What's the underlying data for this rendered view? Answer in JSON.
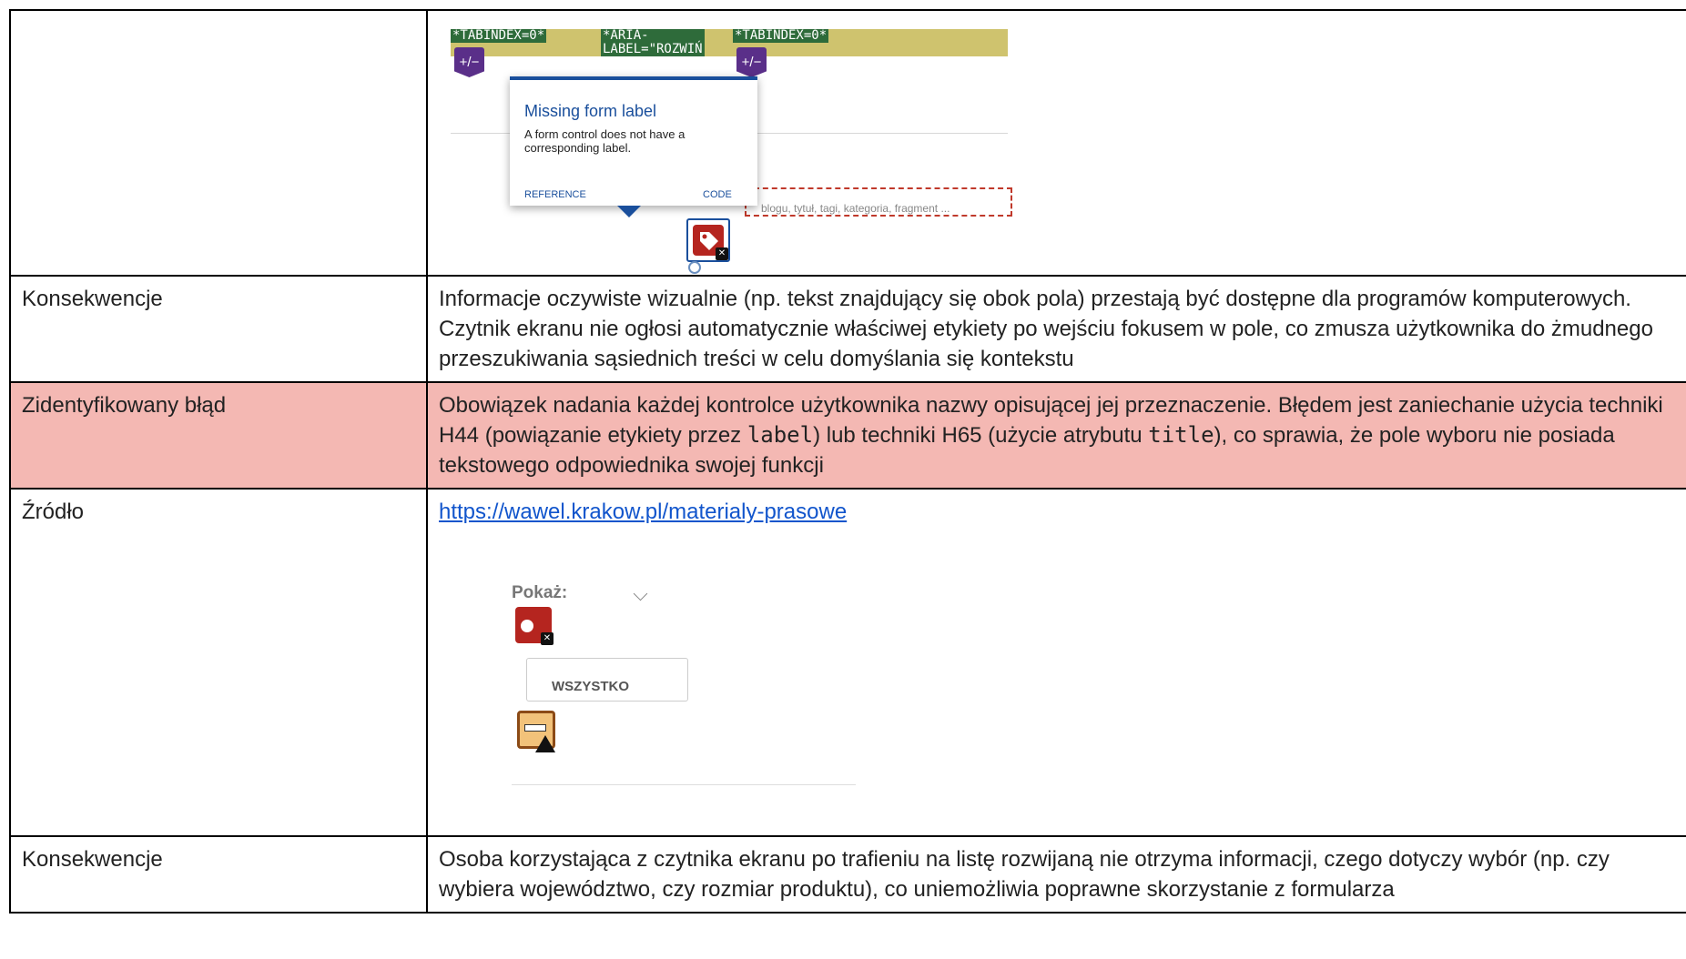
{
  "rows": [
    {
      "label": "",
      "screenshot": {
        "tab_tags": [
          "*TABINDEX=0*",
          "*ARIA-LABEL=\"ROZWIŃ MENU SKLEP\"*",
          "*TABINDEX=0*"
        ],
        "expand_badge": "+/−",
        "popup": {
          "title": "Missing form label",
          "body": "A form control does not have a corresponding label.",
          "reference": "REFERENCE",
          "code": "CODE"
        },
        "search_placeholder": "blogu, tytuł, tagi, kategoria, fragment ..."
      }
    },
    {
      "label": "Konsekwencje",
      "text": "Informacje oczywiste wizualnie (np. tekst znajdujący się obok pola) przestają być dostępne dla programów komputerowych. Czytnik ekranu nie ogłosi automatycznie właściwej etykiety po wejściu fokusem w pole, co zmusza użytkownika do żmudnego przeszukiwania sąsiednich treści w celu domyślania się kontekstu"
    },
    {
      "label": "Zidentyfikowany błąd",
      "text_parts": [
        "Obowiązek nadania każdej kontrolce użytkownika nazwy opisującej jej przeznaczenie. Błędem jest zaniechanie użycia techniki ",
        "H44",
        " (powiązanie etykiety przez ",
        "label",
        ") lub techniki ",
        "H65",
        " (użycie atrybutu ",
        "title",
        "), co sprawia, że pole wyboru nie posiada tekstowego odpowiednika swojej funkcji"
      ],
      "highlight_color": "#f4b8b3"
    },
    {
      "label": "Źródło",
      "link": "https://wawel.krakow.pl/materialy-prasowe",
      "screenshot": {
        "show_label": "Pokaż:",
        "select_value": "WSZYSTKO"
      }
    },
    {
      "label": "Konsekwencje",
      "text": "Osoba korzystająca z czytnika ekranu po trafieniu na listę rozwijaną nie otrzyma informacji, czego dotyczy wybór (np. czy wybiera województwo, czy rozmiar produktu), co uniemożliwia poprawne skorzystanie z formularza"
    }
  ]
}
